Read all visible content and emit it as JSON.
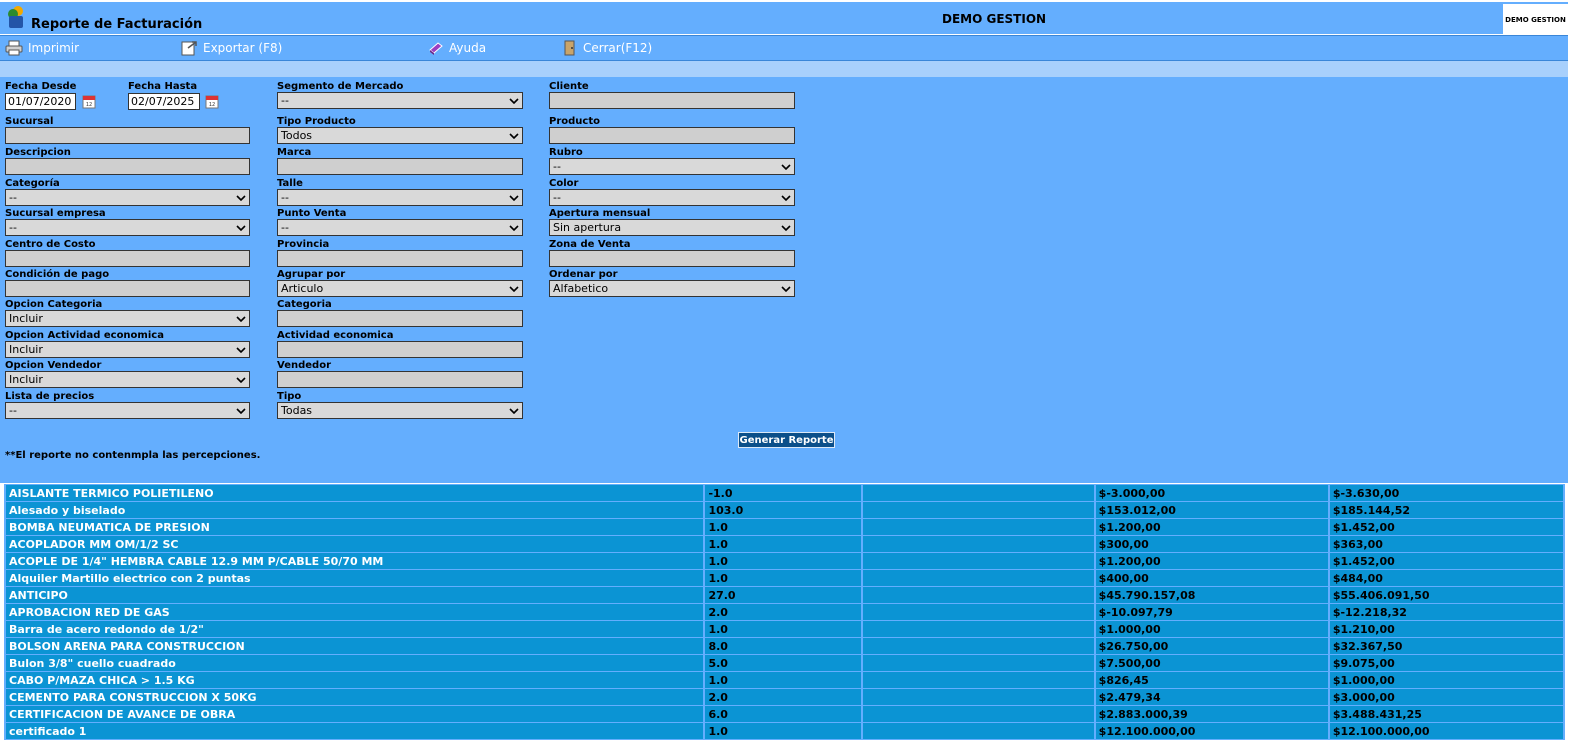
{
  "header": {
    "app_title": "Reporte de Facturación",
    "company": "DEMO GESTION",
    "brand_text": "DEMO GESTION"
  },
  "menu": {
    "print": "Imprimir",
    "export": "Exportar (F8)",
    "help": "Ayuda",
    "close": "Cerrar(F12)"
  },
  "filters": {
    "fecha_desde": {
      "label": "Fecha Desde",
      "value": "01/07/2020"
    },
    "fecha_hasta": {
      "label": "Fecha Hasta",
      "value": "02/07/2025"
    },
    "segmento": {
      "label": "Segmento de Mercado",
      "value": "--"
    },
    "cliente": {
      "label": "Cliente",
      "value": ""
    },
    "sucursal": {
      "label": "Sucursal",
      "value": ""
    },
    "tipo_producto": {
      "label": "Tipo Producto",
      "value": "Todos"
    },
    "producto": {
      "label": "Producto",
      "value": ""
    },
    "descripcion": {
      "label": "Descripcion",
      "value": ""
    },
    "marca": {
      "label": "Marca",
      "value": ""
    },
    "rubro": {
      "label": "Rubro",
      "value": "--"
    },
    "categoria": {
      "label": "Categoría",
      "value": "--"
    },
    "talle": {
      "label": "Talle",
      "value": "--"
    },
    "color": {
      "label": "Color",
      "value": "--"
    },
    "sucursal_empresa": {
      "label": "Sucursal empresa",
      "value": "--"
    },
    "punto_venta": {
      "label": "Punto Venta",
      "value": "--"
    },
    "apertura_mensual": {
      "label": "Apertura mensual",
      "value": "Sin apertura"
    },
    "centro_costo": {
      "label": "Centro de Costo",
      "value": ""
    },
    "provincia": {
      "label": "Provincia",
      "value": ""
    },
    "zona_venta": {
      "label": "Zona de Venta",
      "value": ""
    },
    "condicion_pago": {
      "label": "Condición de pago",
      "value": ""
    },
    "agrupar_por": {
      "label": "Agrupar por",
      "value": "Articulo"
    },
    "ordenar_por": {
      "label": "Ordenar por",
      "value": "Alfabetico"
    },
    "opcion_categoria": {
      "label": "Opcion Categoria",
      "value": "Incluir"
    },
    "categoria2": {
      "label": "Categoria",
      "value": ""
    },
    "opcion_actividad": {
      "label": "Opcion Actividad economica",
      "value": "Incluir"
    },
    "actividad": {
      "label": "Actividad economica",
      "value": ""
    },
    "opcion_vendedor": {
      "label": "Opcion Vendedor",
      "value": "Incluir"
    },
    "vendedor": {
      "label": "Vendedor",
      "value": ""
    },
    "lista_precios": {
      "label": "Lista de precios",
      "value": "--"
    },
    "tipo": {
      "label": "Tipo",
      "value": "Todas"
    }
  },
  "generate_button": "Generar Reporte",
  "note": "**El reporte no contenmpla las percepciones.",
  "rows": [
    {
      "name": "AISLANTE TERMICO POLIETILENO",
      "qty": "-1.0",
      "blank": "",
      "neto": "$-3.000,00",
      "total": "$-3.630,00"
    },
    {
      "name": "Alesado y biselado",
      "qty": "103.0",
      "blank": "",
      "neto": "$153.012,00",
      "total": "$185.144,52"
    },
    {
      "name": "BOMBA NEUMATICA DE PRESION",
      "qty": "1.0",
      "blank": "",
      "neto": "$1.200,00",
      "total": "$1.452,00"
    },
    {
      "name": "ACOPLADOR MM OM/1/2 SC",
      "qty": "1.0",
      "blank": "",
      "neto": "$300,00",
      "total": "$363,00"
    },
    {
      "name": "ACOPLE DE 1/4\" HEMBRA CABLE 12.9 MM P/CABLE 50/70 MM",
      "qty": "1.0",
      "blank": "",
      "neto": "$1.200,00",
      "total": "$1.452,00"
    },
    {
      "name": "Alquiler Martillo electrico con 2 puntas",
      "qty": "1.0",
      "blank": "",
      "neto": "$400,00",
      "total": "$484,00"
    },
    {
      "name": "ANTICIPO",
      "qty": "27.0",
      "blank": "",
      "neto": "$45.790.157,08",
      "total": "$55.406.091,50"
    },
    {
      "name": "APROBACION RED DE GAS",
      "qty": "2.0",
      "blank": "",
      "neto": "$-10.097,79",
      "total": "$-12.218,32"
    },
    {
      "name": "Barra de acero redondo de 1/2\"",
      "qty": "1.0",
      "blank": "",
      "neto": "$1.000,00",
      "total": "$1.210,00"
    },
    {
      "name": "BOLSON ARENA PARA CONSTRUCCION",
      "qty": "8.0",
      "blank": "",
      "neto": "$26.750,00",
      "total": "$32.367,50"
    },
    {
      "name": "Bulon 3/8\" cuello cuadrado",
      "qty": "5.0",
      "blank": "",
      "neto": "$7.500,00",
      "total": "$9.075,00"
    },
    {
      "name": "CABO P/MAZA CHICA > 1.5 KG",
      "qty": "1.0",
      "blank": "",
      "neto": "$826,45",
      "total": "$1.000,00"
    },
    {
      "name": "CEMENTO PARA CONSTRUCCION X 50KG",
      "qty": "2.0",
      "blank": "",
      "neto": "$2.479,34",
      "total": "$3.000,00"
    },
    {
      "name": "CERTIFICACION DE AVANCE DE OBRA",
      "qty": "6.0",
      "blank": "",
      "neto": "$2.883.000,39",
      "total": "$3.488.431,25"
    },
    {
      "name": "certificado 1",
      "qty": "1.0",
      "blank": "",
      "neto": "$12.100.000,00",
      "total": "$12.100.000,00"
    }
  ]
}
